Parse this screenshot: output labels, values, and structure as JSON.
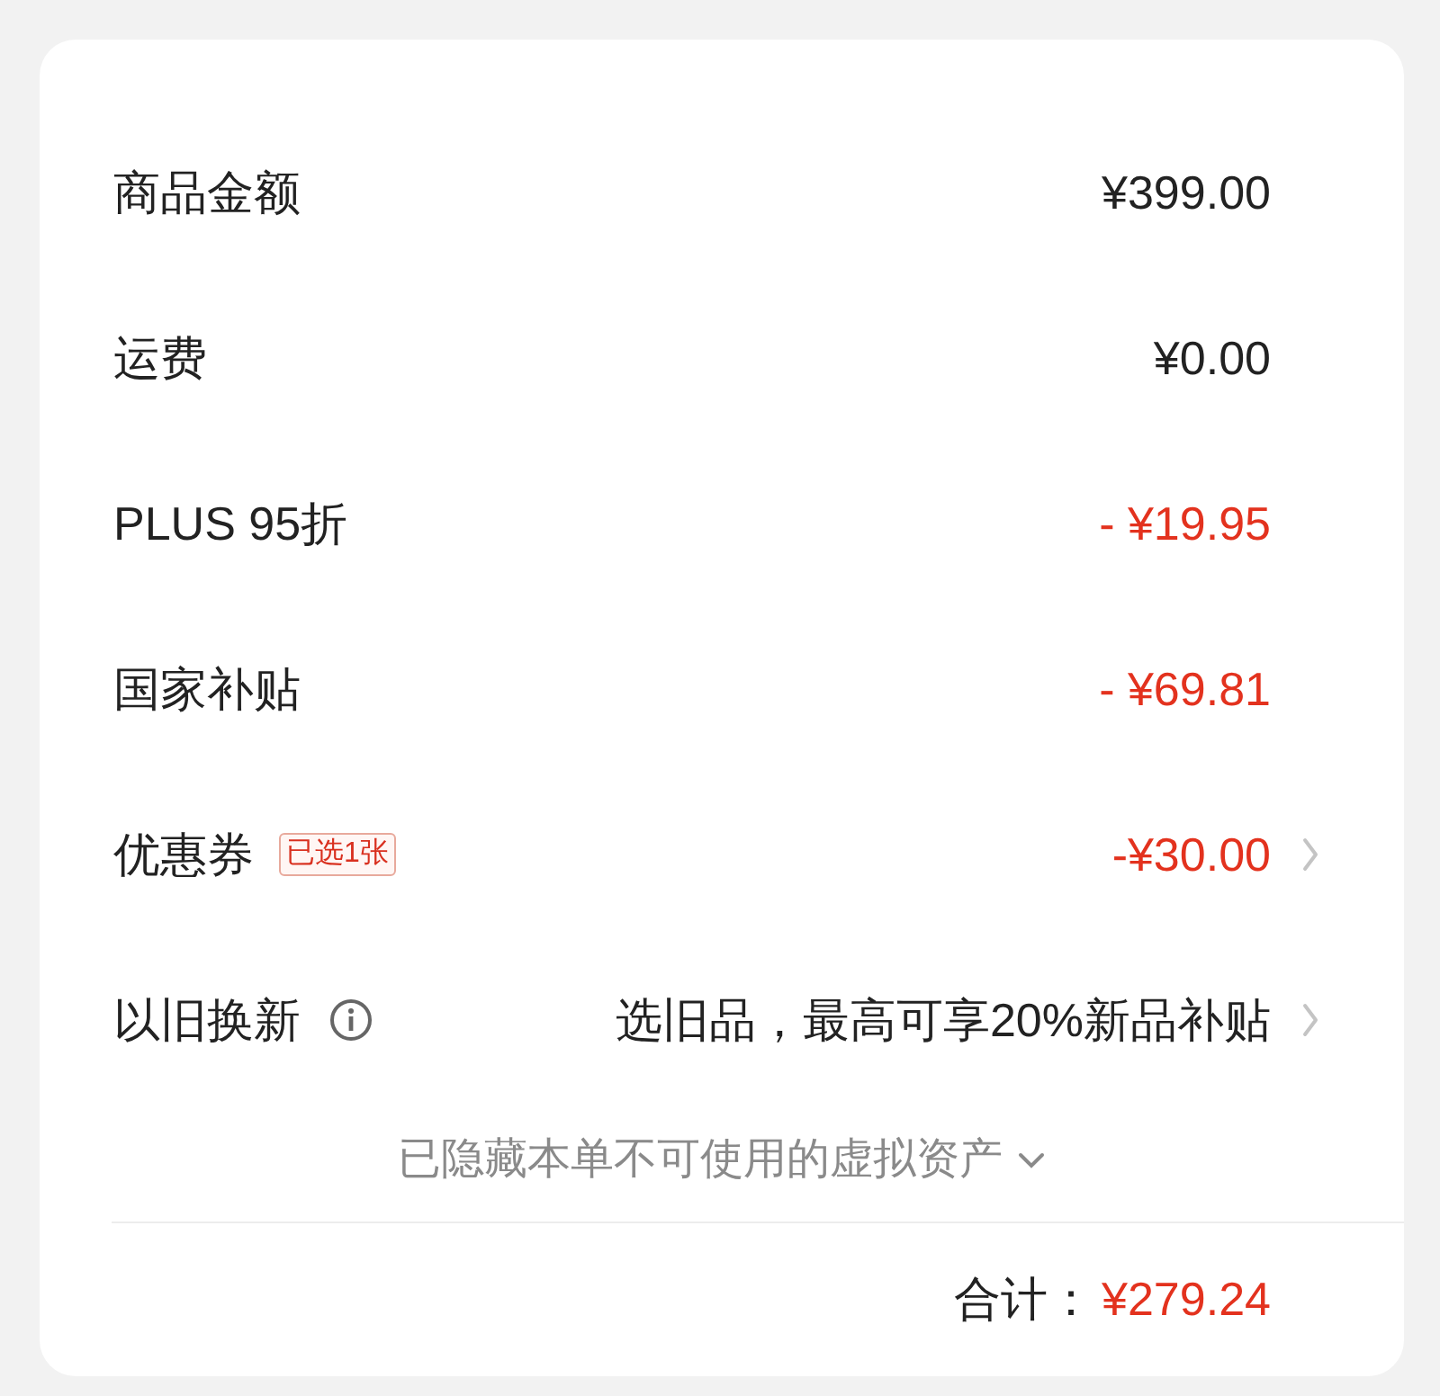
{
  "rows": [
    {
      "kind": "plain",
      "label": "商品金额",
      "value": "¥399.00"
    },
    {
      "kind": "plain",
      "label": "运费",
      "value": "¥0.00"
    },
    {
      "kind": "discount",
      "label": "PLUS 95折",
      "value": "- ¥19.95"
    },
    {
      "kind": "discount",
      "label": "国家补贴",
      "value": "- ¥69.81"
    },
    {
      "kind": "coupon",
      "label": "优惠券",
      "tag": "已选1张",
      "value": "-¥30.00"
    },
    {
      "kind": "tradein",
      "label": "以旧换新",
      "value": "选旧品，最高可享20%新品补贴"
    }
  ],
  "hidden_assets": {
    "text": "已隐藏本单不可使用的虚拟资产",
    "expanded": false
  },
  "total": {
    "label": "合计：",
    "value": "¥279.24"
  }
}
